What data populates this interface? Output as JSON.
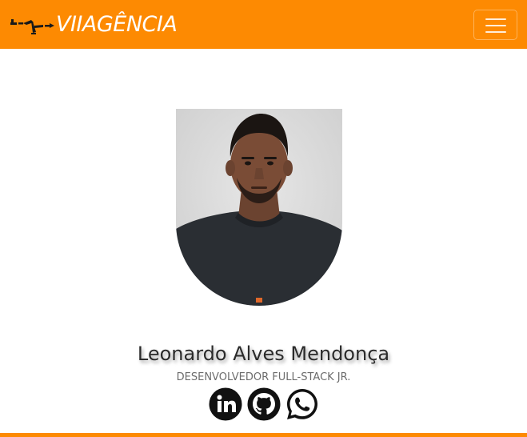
{
  "navbar": {
    "brand_text": "VIIAGÊNCIA",
    "brand_icon": "airplane-icon",
    "toggler_icon": "hamburger-menu-icon"
  },
  "profile": {
    "name": "Leonardo Alves Mendonça",
    "role": "DESENVOLVEDOR FULL-STACK JR.",
    "photo": "profile-photo"
  },
  "social": {
    "items": [
      {
        "icon": "linkedin-icon"
      },
      {
        "icon": "github-icon"
      },
      {
        "icon": "whatsapp-icon"
      }
    ]
  },
  "colors": {
    "accent": "#fd8a02",
    "text": "#2b2b2b",
    "muted": "#6c6c6c"
  }
}
